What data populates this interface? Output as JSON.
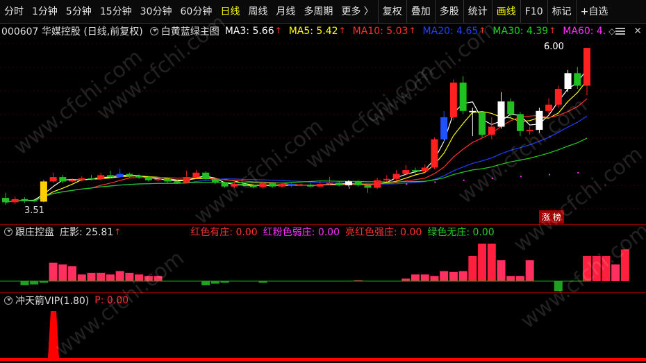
{
  "toolbar": {
    "periods": [
      "分时",
      "1分钟",
      "5分钟",
      "15分钟",
      "30分钟",
      "60分钟",
      "日线",
      "周线",
      "月线",
      "多周期",
      "更多 〉"
    ],
    "active_period": "日线",
    "buttons": [
      "复权",
      "叠加",
      "多股",
      "统计",
      "画线",
      "F10",
      "标记",
      "+自选"
    ],
    "highlight_button": "画线"
  },
  "main_info": {
    "stock": "000607  华媒控股 (日线,前复权)",
    "indicator": "白黄蓝绿主图",
    "ma": [
      {
        "label": "MA3: 5.66",
        "color": "#ffffff"
      },
      {
        "label": "MA5: 5.42",
        "color": "#ffff00"
      },
      {
        "label": "MA10: 5.03",
        "color": "#ff3030"
      },
      {
        "label": "MA20: 4.65",
        "color": "#2040ff"
      },
      {
        "label": "MA30: 4.39",
        "color": "#20d020"
      },
      {
        "label": "MA60: 4.",
        "color": "#ff30ff"
      }
    ]
  },
  "price_high_label": "6.00",
  "price_low_label": "3.51",
  "zhangbang_label": "涨 榜",
  "sub1_info": {
    "title": "跟庄控盘",
    "zhuangying": "庄影: 25.81",
    "items": [
      {
        "label": "红色有庄: 0.00",
        "color": "#ff3030"
      },
      {
        "label": "红粉色弱庄: 0.00",
        "color": "#ff30ff"
      },
      {
        "label": "亮红色强庄: 0.00",
        "color": "#ff3030"
      },
      {
        "label": "绿色无庄: 0.00",
        "color": "#20d020"
      }
    ]
  },
  "sub2_info": {
    "title": "冲天箭VIP(1.80)",
    "p_value": "P: 0.00"
  },
  "watermark": "www.cfchi.com",
  "chart_data": {
    "type": "candlestick",
    "candles": [
      {
        "o": 3.62,
        "c": 3.55,
        "h": 3.7,
        "l": 3.51
      },
      {
        "o": 3.55,
        "c": 3.6,
        "h": 3.64,
        "l": 3.52
      },
      {
        "o": 3.6,
        "c": 3.58,
        "h": 3.63,
        "l": 3.54
      },
      {
        "o": 3.58,
        "c": 3.57,
        "h": 3.6,
        "l": 3.55
      },
      {
        "o": 3.56,
        "c": 3.88,
        "h": 3.9,
        "l": 3.55
      },
      {
        "o": 3.88,
        "c": 3.95,
        "h": 4.02,
        "l": 3.86
      },
      {
        "o": 3.95,
        "c": 3.88,
        "h": 3.98,
        "l": 3.85
      },
      {
        "o": 3.88,
        "c": 3.9,
        "h": 3.93,
        "l": 3.86
      },
      {
        "o": 3.9,
        "c": 3.93,
        "h": 3.96,
        "l": 3.88
      },
      {
        "o": 3.93,
        "c": 3.92,
        "h": 3.98,
        "l": 3.9
      },
      {
        "o": 3.92,
        "c": 3.98,
        "h": 4.02,
        "l": 3.9
      },
      {
        "o": 3.98,
        "c": 3.95,
        "h": 4.05,
        "l": 3.93
      },
      {
        "o": 3.95,
        "c": 4.0,
        "h": 4.08,
        "l": 3.94
      },
      {
        "o": 4.0,
        "c": 3.97,
        "h": 4.02,
        "l": 3.94
      },
      {
        "o": 3.97,
        "c": 3.95,
        "h": 3.99,
        "l": 3.92
      },
      {
        "o": 3.95,
        "c": 3.9,
        "h": 3.97,
        "l": 3.88
      },
      {
        "o": 3.9,
        "c": 3.92,
        "h": 3.95,
        "l": 3.88
      },
      {
        "o": 3.92,
        "c": 3.88,
        "h": 3.94,
        "l": 3.86
      },
      {
        "o": 3.88,
        "c": 3.86,
        "h": 3.9,
        "l": 3.84
      },
      {
        "o": 3.86,
        "c": 3.95,
        "h": 4.05,
        "l": 3.85
      },
      {
        "o": 3.95,
        "c": 4.02,
        "h": 4.06,
        "l": 3.94
      },
      {
        "o": 4.02,
        "c": 3.92,
        "h": 4.04,
        "l": 3.9
      },
      {
        "o": 3.92,
        "c": 3.86,
        "h": 3.94,
        "l": 3.84
      },
      {
        "o": 3.86,
        "c": 3.8,
        "h": 3.88,
        "l": 3.78
      },
      {
        "o": 3.8,
        "c": 3.84,
        "h": 3.87,
        "l": 3.78
      },
      {
        "o": 3.84,
        "c": 3.82,
        "h": 3.86,
        "l": 3.8
      },
      {
        "o": 3.82,
        "c": 3.79,
        "h": 3.84,
        "l": 3.77
      },
      {
        "o": 3.79,
        "c": 3.85,
        "h": 3.88,
        "l": 3.77
      },
      {
        "o": 3.85,
        "c": 3.8,
        "h": 3.87,
        "l": 3.78
      },
      {
        "o": 3.8,
        "c": 3.84,
        "h": 3.86,
        "l": 3.78
      },
      {
        "o": 3.84,
        "c": 3.81,
        "h": 3.86,
        "l": 3.79
      },
      {
        "o": 3.81,
        "c": 3.83,
        "h": 3.85,
        "l": 3.8
      },
      {
        "o": 3.83,
        "c": 3.8,
        "h": 3.85,
        "l": 3.79
      },
      {
        "o": 3.8,
        "c": 3.84,
        "h": 3.88,
        "l": 3.79
      },
      {
        "o": 3.84,
        "c": 3.86,
        "h": 3.95,
        "l": 3.82
      },
      {
        "o": 3.86,
        "c": 3.82,
        "h": 3.88,
        "l": 3.8
      },
      {
        "o": 3.82,
        "c": 3.88,
        "h": 3.9,
        "l": 3.8
      },
      {
        "o": 3.88,
        "c": 3.82,
        "h": 3.9,
        "l": 3.8
      },
      {
        "o": 3.82,
        "c": 3.78,
        "h": 3.84,
        "l": 3.7
      },
      {
        "o": 3.78,
        "c": 3.9,
        "h": 3.94,
        "l": 3.76
      },
      {
        "o": 3.9,
        "c": 3.92,
        "h": 3.98,
        "l": 3.88
      },
      {
        "o": 3.92,
        "c": 4.0,
        "h": 4.06,
        "l": 3.9
      },
      {
        "o": 4.0,
        "c": 4.06,
        "h": 4.14,
        "l": 3.98
      },
      {
        "o": 4.06,
        "c": 4.04,
        "h": 4.1,
        "l": 4.0
      },
      {
        "o": 4.04,
        "c": 4.1,
        "h": 4.15,
        "l": 4.02
      },
      {
        "o": 4.1,
        "c": 4.55,
        "h": 4.58,
        "l": 4.08
      },
      {
        "o": 4.55,
        "c": 4.9,
        "h": 5.0,
        "l": 4.5
      },
      {
        "o": 4.9,
        "c": 5.45,
        "h": 5.5,
        "l": 4.85
      },
      {
        "o": 5.45,
        "c": 5.0,
        "h": 5.55,
        "l": 4.95
      },
      {
        "o": 5.0,
        "c": 4.98,
        "h": 5.05,
        "l": 4.6
      },
      {
        "o": 4.98,
        "c": 4.62,
        "h": 4.96,
        "l": 4.58
      },
      {
        "o": 4.62,
        "c": 4.75,
        "h": 4.9,
        "l": 4.55
      },
      {
        "o": 4.75,
        "c": 5.15,
        "h": 5.3,
        "l": 4.72
      },
      {
        "o": 5.15,
        "c": 4.95,
        "h": 5.2,
        "l": 4.9
      },
      {
        "o": 4.95,
        "c": 4.68,
        "h": 4.98,
        "l": 4.6
      },
      {
        "o": 4.68,
        "c": 4.7,
        "h": 4.75,
        "l": 4.62
      },
      {
        "o": 4.7,
        "c": 5.0,
        "h": 5.05,
        "l": 4.65
      },
      {
        "o": 5.0,
        "c": 5.1,
        "h": 5.2,
        "l": 4.95
      },
      {
        "o": 5.1,
        "c": 5.35,
        "h": 5.4,
        "l": 5.05
      },
      {
        "o": 5.35,
        "c": 5.6,
        "h": 5.65,
        "l": 5.3
      },
      {
        "o": 5.6,
        "c": 5.4,
        "h": 5.7,
        "l": 5.35
      },
      {
        "o": 5.4,
        "c": 6.0,
        "h": 6.0,
        "l": 5.25
      }
    ],
    "sub1_bars": [
      0,
      0,
      -0.5,
      -0.4,
      -0.2,
      2.2,
      2.0,
      1.8,
      0.8,
      1.0,
      1.0,
      0.8,
      1.2,
      1.0,
      0.8,
      0.6,
      0.6,
      0,
      0,
      0,
      0,
      -0.5,
      -0.3,
      -0.2,
      0,
      0,
      0,
      -0.2,
      0,
      0,
      0,
      0,
      0,
      0,
      0,
      0,
      0,
      0.1,
      0,
      0,
      0,
      0,
      0.3,
      0.8,
      0.8,
      0.6,
      1.2,
      1.1,
      1.2,
      3.0,
      4.5,
      4.5,
      2.5,
      0.6,
      0.6,
      2.5,
      0,
      0,
      -1.2,
      0,
      0,
      3.0,
      3.0,
      3.0,
      2.0,
      3.8
    ],
    "sub2_spike_index": 3,
    "ylim": [
      3.4,
      6.1
    ]
  }
}
